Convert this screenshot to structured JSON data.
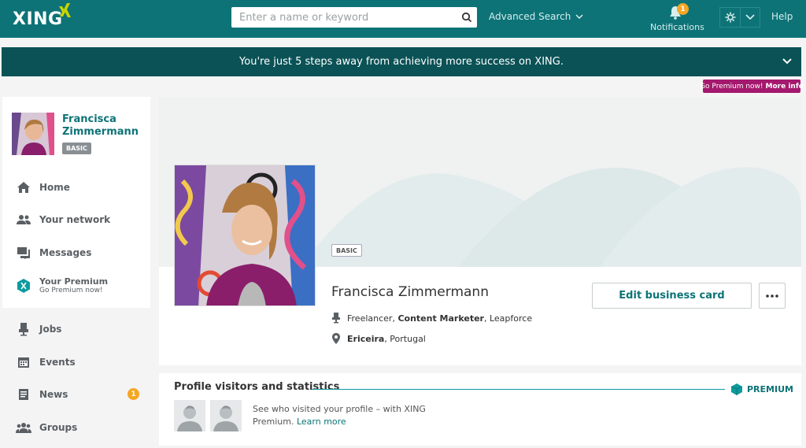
{
  "header": {
    "brand": "XING",
    "search_placeholder": "Enter a name or keyword",
    "advanced_search": "Advanced Search",
    "notifications_label": "Notifications",
    "notifications_count": "1",
    "help": "Help"
  },
  "banner": {
    "text": "You're just 5 steps away from achieving more success on XING.",
    "premium_pill_text": "Go Premium now!",
    "premium_pill_link": "More info"
  },
  "sidebar": {
    "user_name": "Francisca Zimmermann",
    "membership": "BASIC",
    "items": [
      {
        "label": "Home",
        "icon": "home-icon"
      },
      {
        "label": "Your network",
        "icon": "network-icon"
      },
      {
        "label": "Messages",
        "icon": "messages-icon"
      },
      {
        "label": "Jobs",
        "icon": "jobs-icon"
      },
      {
        "label": "Events",
        "icon": "events-icon"
      },
      {
        "label": "News",
        "icon": "news-icon",
        "badge": "1"
      },
      {
        "label": "Groups",
        "icon": "groups-icon"
      }
    ],
    "premium": {
      "title": "Your Premium",
      "subtitle": "Go Premium now!"
    }
  },
  "profile": {
    "membership": "BASIC",
    "name": "Francisca Zimmermann",
    "job_prefix": "Freelancer,",
    "job_title": "Content Marketer",
    "job_suffix": ", Leapforce",
    "city": "Ericeira",
    "country": ", Portugal",
    "edit_button": "Edit business card"
  },
  "visitors": {
    "title": "Profile visitors and statistics",
    "premium_label": "PREMIUM",
    "text": "See who visited your profile – with XING Premium.",
    "learn_more": "Learn more"
  },
  "colors": {
    "brand": "#0d7377",
    "banner": "#0a5256",
    "badge": "#f5a623",
    "premium_pill": "#a4186e"
  }
}
